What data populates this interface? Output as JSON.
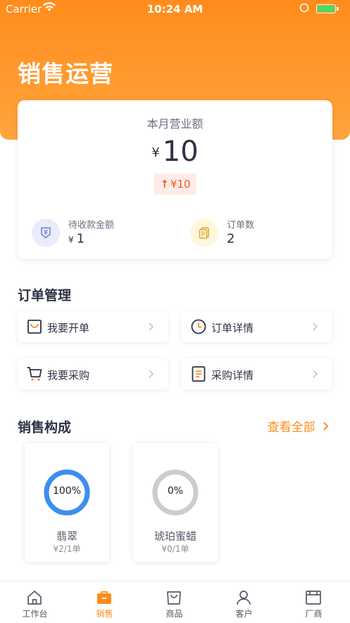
{
  "status_bar": {
    "carrier": "Carrier",
    "time": "10:24 AM"
  },
  "header": {
    "title": "销售运营"
  },
  "summary": {
    "label": "本月营业额",
    "currency": "¥",
    "amount": "10",
    "change": "¥10",
    "change_direction": "up",
    "receivable": {
      "label": "待收款金额",
      "currency": "¥",
      "value": "1",
      "icon": "receivable-icon"
    },
    "orders": {
      "label": "订单数",
      "value": "2",
      "icon": "document-icon"
    }
  },
  "order_management": {
    "title": "订单管理",
    "actions": [
      {
        "label": "我要开单",
        "icon": "shopping-bag-icon"
      },
      {
        "label": "订单详情",
        "icon": "clock-icon"
      },
      {
        "label": "我要采购",
        "icon": "cart-icon"
      },
      {
        "label": "采购详情",
        "icon": "list-doc-icon"
      }
    ]
  },
  "sales_composition": {
    "title": "销售构成",
    "view_all": "查看全部",
    "items": [
      {
        "name": "翡翠",
        "percent_label": "100%",
        "percent": 100,
        "sub": "¥2/1单"
      },
      {
        "name": "琥珀蜜蜡",
        "percent_label": "0%",
        "percent": 0,
        "sub": "¥0/1单"
      }
    ]
  },
  "tab_bar": {
    "tabs": [
      {
        "label": "工作台",
        "icon": "home-icon",
        "active": false
      },
      {
        "label": "销售",
        "icon": "sales-bag-icon",
        "active": true
      },
      {
        "label": "商品",
        "icon": "product-bag-icon",
        "active": false
      },
      {
        "label": "客户",
        "icon": "person-icon",
        "active": false
      },
      {
        "label": "厂商",
        "icon": "factory-icon",
        "active": false
      }
    ]
  },
  "colors": {
    "accent": "#ff8c1c",
    "text": "#2e3345",
    "ring_track": "#cccccc",
    "ring_fill": "#3d8ef0",
    "badge_bg": "#ffece6",
    "badge_text": "#f05a2a"
  }
}
